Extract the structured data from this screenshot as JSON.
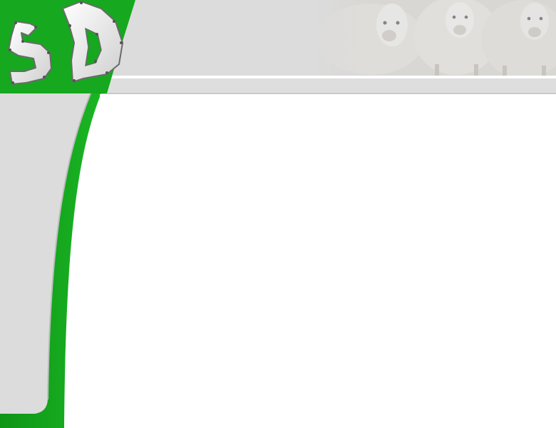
{
  "site": {
    "logo_text": "SD",
    "brand_color": "#16a81e",
    "panel_color": "#dcdcdc"
  },
  "banner": {
    "image": "sheep-flock-photo"
  },
  "icons": {
    "logo": "sd-logo-icon"
  }
}
